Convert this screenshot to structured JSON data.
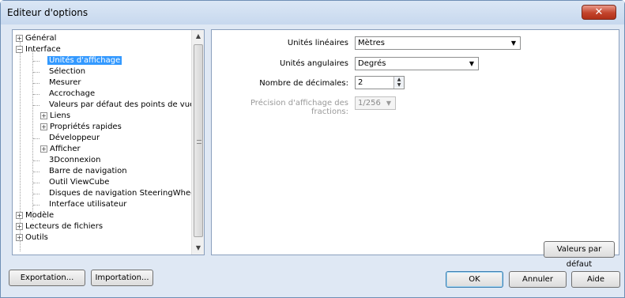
{
  "window": {
    "title": "Editeur d'options",
    "close_label": "✕"
  },
  "tree": {
    "items": [
      {
        "label": "Général",
        "expander": "+"
      },
      {
        "label": "Interface",
        "expander": "−"
      },
      {
        "label": "Unités d'affichage",
        "selected": true
      },
      {
        "label": "Sélection"
      },
      {
        "label": "Mesurer"
      },
      {
        "label": "Accrochage"
      },
      {
        "label": "Valeurs par défaut des points de vue"
      },
      {
        "label": "Liens",
        "expander": "+"
      },
      {
        "label": "Propriétés rapides",
        "expander": "+"
      },
      {
        "label": "Développeur"
      },
      {
        "label": "Afficher",
        "expander": "+"
      },
      {
        "label": "3Dconnexion"
      },
      {
        "label": "Barre de navigation"
      },
      {
        "label": "Outil ViewCube"
      },
      {
        "label": "Disques de navigation SteeringWheels"
      },
      {
        "label": "Interface utilisateur"
      },
      {
        "label": "Modèle",
        "expander": "+"
      },
      {
        "label": "Lecteurs de fichiers",
        "expander": "+"
      },
      {
        "label": "Outils",
        "expander": "+"
      }
    ]
  },
  "settings": {
    "linear_units": {
      "label": "Unités linéaires",
      "value": "Mètres"
    },
    "angular_units": {
      "label": "Unités angulaires",
      "value": "Degrés"
    },
    "decimals": {
      "label": "Nombre de décimales:",
      "value": "2"
    },
    "fraction_precision": {
      "label": "Précision d'affichage des fractions:",
      "value": "1/256"
    },
    "defaults_button": "Valeurs par défaut"
  },
  "footer": {
    "export_button": "Exportation...",
    "import_button": "Importation...",
    "ok_button": "OK",
    "cancel_button": "Annuler",
    "help_button": "Aide"
  }
}
